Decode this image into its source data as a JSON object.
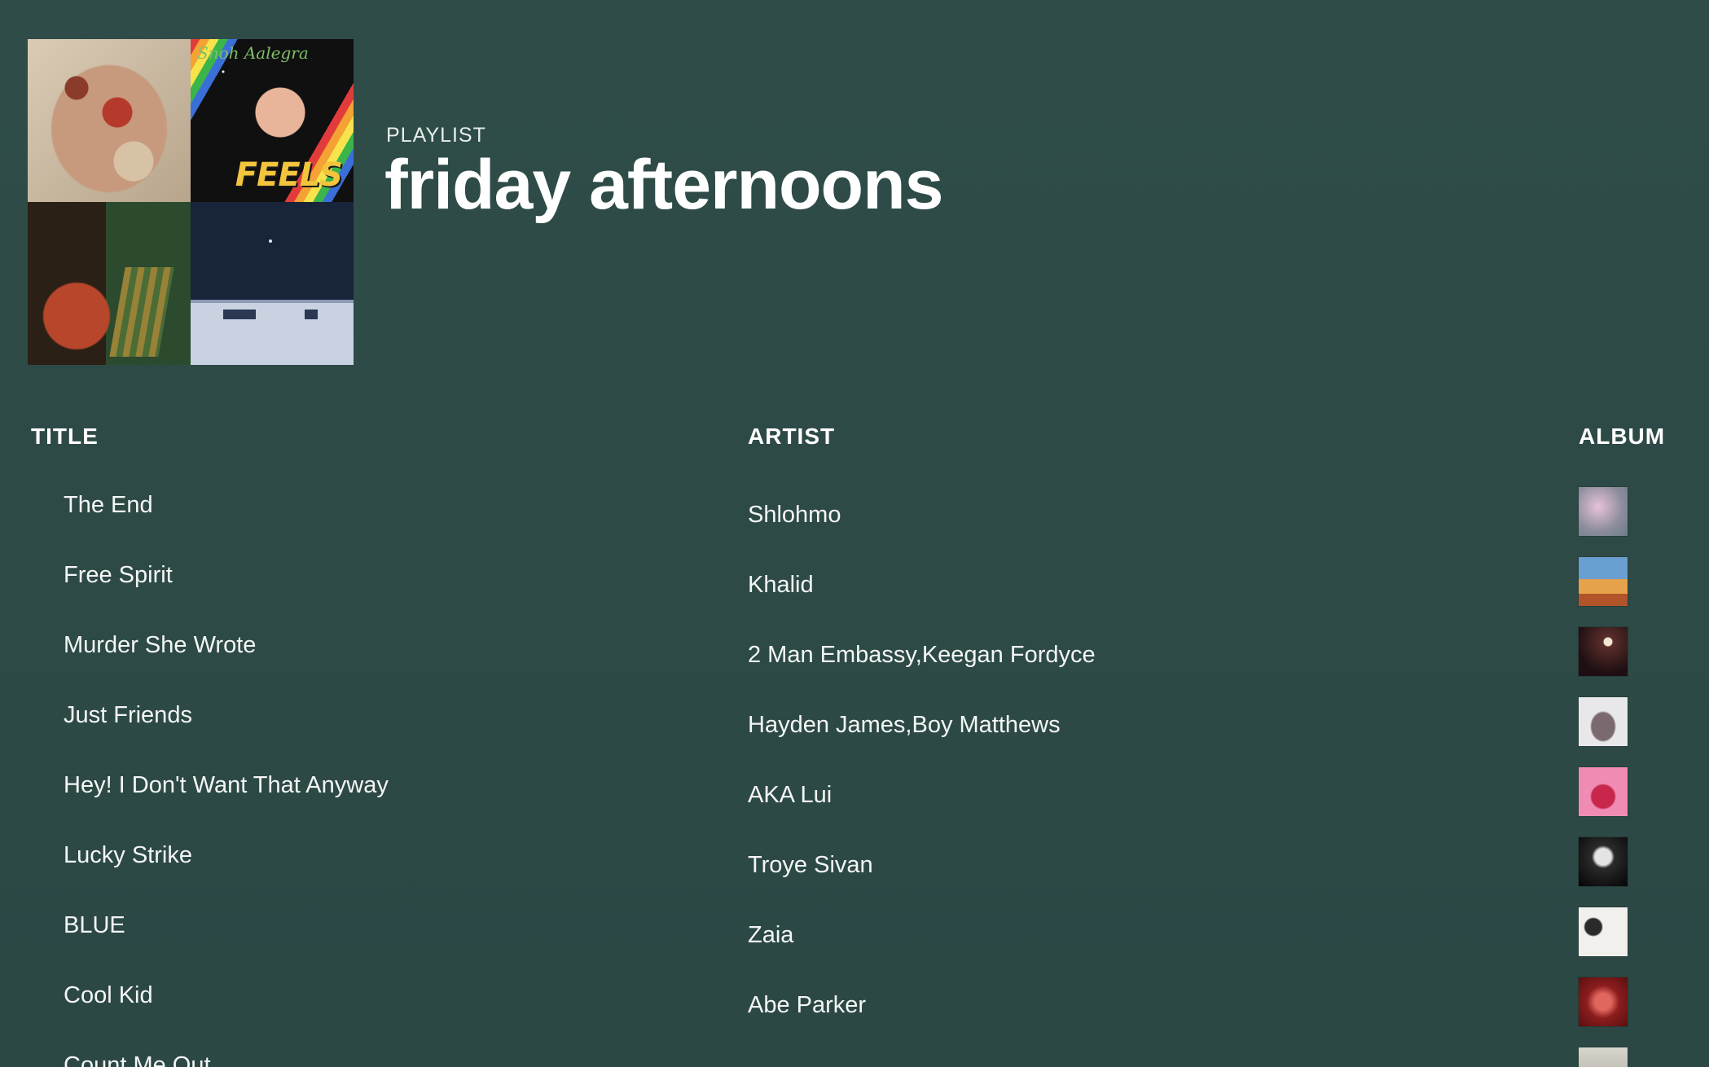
{
  "header": {
    "label": "PLAYLIST",
    "title": "friday afternoons",
    "cover_feels_text": "FEELS",
    "cover_artist_script": "Snoh Aalegra"
  },
  "columns": {
    "title": "TITLE",
    "artist": "ARTIST",
    "album": "ALBUM"
  },
  "tracks": [
    {
      "title": "The End",
      "artist": "Shlohmo"
    },
    {
      "title": "Free Spirit",
      "artist": "Khalid"
    },
    {
      "title": "Murder She Wrote",
      "artist": "2 Man Embassy,Keegan Fordyce"
    },
    {
      "title": "Just Friends",
      "artist": "Hayden James,Boy Matthews"
    },
    {
      "title": "Hey! I Don't Want That Anyway",
      "artist": "AKA Lui"
    },
    {
      "title": "Lucky Strike",
      "artist": "Troye Sivan"
    },
    {
      "title": "BLUE",
      "artist": "Zaia"
    },
    {
      "title": "Cool Kid",
      "artist": "Abe Parker"
    },
    {
      "title": "Count Me Out",
      "artist": ""
    }
  ],
  "colors": {
    "background": "#2e4a47",
    "text": "#ffffff"
  }
}
